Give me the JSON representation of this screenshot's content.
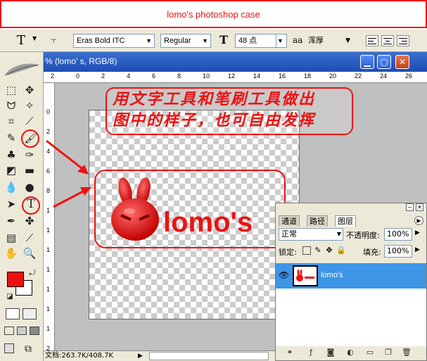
{
  "banner": {
    "title": "lomo's photoshop case"
  },
  "options": {
    "tool_glyph": "T",
    "font_family": "Eras Bold ITC",
    "font_style": "Regular",
    "font_size": "48 点",
    "aa_glyph": "aa",
    "antialias": "浑厚"
  },
  "document": {
    "title": "% (lomo'  s, RGB/8)",
    "ruler_top": [
      "2",
      "0",
      "2",
      "4",
      "6",
      "8",
      "10",
      "12",
      "14",
      "16",
      "18",
      "20",
      "22",
      "24",
      "26"
    ],
    "ruler_left": [
      "0",
      "2",
      "4",
      "6",
      "8",
      "1",
      "1",
      "1",
      "1",
      "1",
      "1",
      "1",
      "2"
    ],
    "status": "文档:263.7K/408.7K"
  },
  "annotation": {
    "line1": "用文字工具和笔刷工具做出",
    "line2": "图中的样子，也可自由发挥"
  },
  "artwork": {
    "text": "lomo's"
  },
  "layers_panel": {
    "tabs": [
      "通道",
      "路径",
      "图层"
    ],
    "blend_mode": "正常",
    "opacity_label": "不透明度:",
    "opacity_value": "100%",
    "lock_label": "锁定:",
    "fill_label": "填充:",
    "fill_value": "100%",
    "layer_name": "lomo's"
  },
  "colors": {
    "accent": "#ee1111",
    "selection": "#3d95e6",
    "foreground": "#ee1111",
    "background": "#ffffff"
  }
}
